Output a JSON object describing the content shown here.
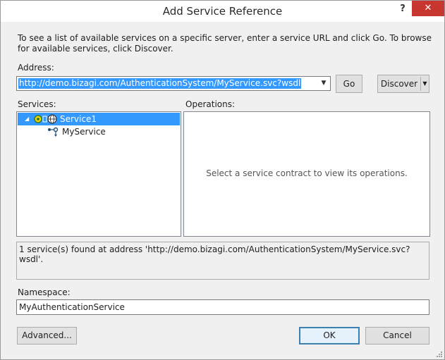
{
  "window": {
    "title": "Add Service Reference",
    "help_label": "?",
    "close_label": "✕"
  },
  "instructions": "To see a list of available services on a specific server, enter a service URL and click Go. To browse for available services, click Discover.",
  "address": {
    "label": "Address:",
    "value": "http://demo.bizagi.com/AuthenticationSystem/MyService.svc?wsdl",
    "dropdown_icon": "chevron-down-icon"
  },
  "buttons": {
    "go": "Go",
    "discover": "Discover",
    "advanced": "Advanced...",
    "ok": "OK",
    "cancel": "Cancel"
  },
  "services": {
    "label": "Services:",
    "tree": [
      {
        "label": "Service1",
        "icon": "service-icon",
        "expanded": true,
        "selected": true
      },
      {
        "label": "MyService",
        "icon": "service-contract-icon",
        "selected": false
      }
    ]
  },
  "operations": {
    "label": "Operations:",
    "empty_message": "Select a service contract to view its operations."
  },
  "status_message": "1 service(s) found at address 'http://demo.bizagi.com/AuthenticationSystem/MyService.svc?wsdl'.",
  "namespace": {
    "label": "Namespace:",
    "value": "MyAuthenticationService"
  },
  "colors": {
    "selection": "#3399ff",
    "close_button": "#c7372f",
    "default_button_border": "#3c7fb1"
  }
}
